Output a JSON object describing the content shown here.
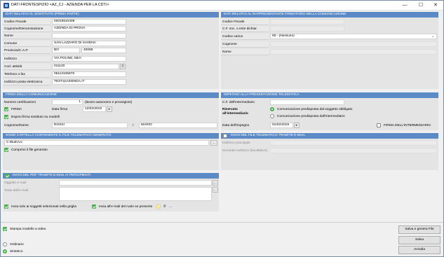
{
  "window": {
    "title": "DATI FRONTESPIZIO <AZ_CJ - AZIENDA PER LA CDT/>",
    "min": "—",
    "max": "☐",
    "close": "✕"
  },
  "sostituto": {
    "header": "DATI RELATIVI AL SOSTITUTO (PRIMA PARTE)",
    "rows": [
      {
        "label": "Codice Fiscale",
        "value": "02019510409"
      },
      {
        "label": "Cognome/Denominazione",
        "value": "AZIENDA DI PROVA"
      },
      {
        "label": "Nome",
        "value": ""
      },
      {
        "label": "Comune",
        "value": "SAN LAZZARO DI SAVENA"
      },
      {
        "label": "Provincia/C.A.P.",
        "value": "BO",
        "value2": "40068"
      },
      {
        "label": "Indirizzo",
        "value": "VIA POLINE, 56/A"
      },
      {
        "label": "Cod. attività",
        "value": "011120"
      },
      {
        "label": "Telefono o fax",
        "value": "05112345678"
      },
      {
        "label": "Indirizzo posta elettronica",
        "value": "TEST@AZIENDA.IT"
      }
    ]
  },
  "rappresentante": {
    "header": "DATI RELATIVI AL RAPPRESENTANTE FIRMATARIO DELLA COMUNICAZIONE",
    "rows": [
      {
        "label": "Codice Fiscale",
        "value": ""
      },
      {
        "label": "C.F. soc. o ente dichiar.",
        "value": ""
      },
      {
        "label": "Codice carica",
        "value": "00 - (Nessuno)"
      },
      {
        "label": "Cognome",
        "value": ""
      },
      {
        "label": "Nome",
        "value": ""
      }
    ]
  },
  "firma": {
    "header": "FIRMA DELLA COMUNICAZIONE",
    "num_cert_label": "Numero certificazioni",
    "num_cert": "1",
    "num_cert_note": "(lavoro autonomo e provvigioni)",
    "firma_label": "FIRMA",
    "data_firma_label": "Data firma",
    "data_firma": "12/02/2019",
    "esponi_label": "Esponi firma sostituto su modelli",
    "cognome_nome_label": "Cognome/Nome",
    "cognome": "ROSSI",
    "slash": "/",
    "nome": "MARIO"
  },
  "impegno": {
    "header": "IMPEGNO ALLA PRESENTAZIONE TELEMATICA",
    "cf_label": "C.F. dell'intermediario",
    "cf": "",
    "riservato_label": "Riservato all'intermediario",
    "opt1": "Comunicazione predisposta dal soggetto obbligato",
    "opt2": "Comunicazione predisposta dall'intermediario",
    "data_label": "Data dell'impegno",
    "data": "01/02/2019",
    "firma_label": "FIRMA DELL'INTERMEDIARIO"
  },
  "cartella": {
    "header": "NOME CARTELLA CONTENENTE IL FILE TELEMATICO GENERATO",
    "path": "C:\\Bull\\Acc",
    "dots": "...",
    "comprimi_label": "Comprimi il file generato"
  },
  "invio_file": {
    "header": "INVIO DEL FILE TELEMATICO TRAMITE E-MAIL",
    "ind1_label": "Indirizzo principale",
    "ind2_label": "Secondo indirizzo (facoltativo)"
  },
  "invio_pdf": {
    "header": "INVIO DEL PDF TRAMITE E-MAIL AI PERCIPIENTI",
    "oggetto_label": "Oggetto e-mail",
    "testo_label": "Testo dell'e-mail",
    "dots": "...",
    "solo_sel_label": "Invia solo ai soggetti selezionati nella griglia",
    "invia_ruolo_label": "Invia all'e-mail del ruolo se presente",
    "dots2": "..."
  },
  "stampa": {
    "label": "Stampa modello a video",
    "ordinario": "Ordinario",
    "sintetico": "Sintetico"
  },
  "buttons": {
    "salva_genera": "Salva e genera File",
    "salva": "Salva",
    "annulla": "Annulla"
  }
}
